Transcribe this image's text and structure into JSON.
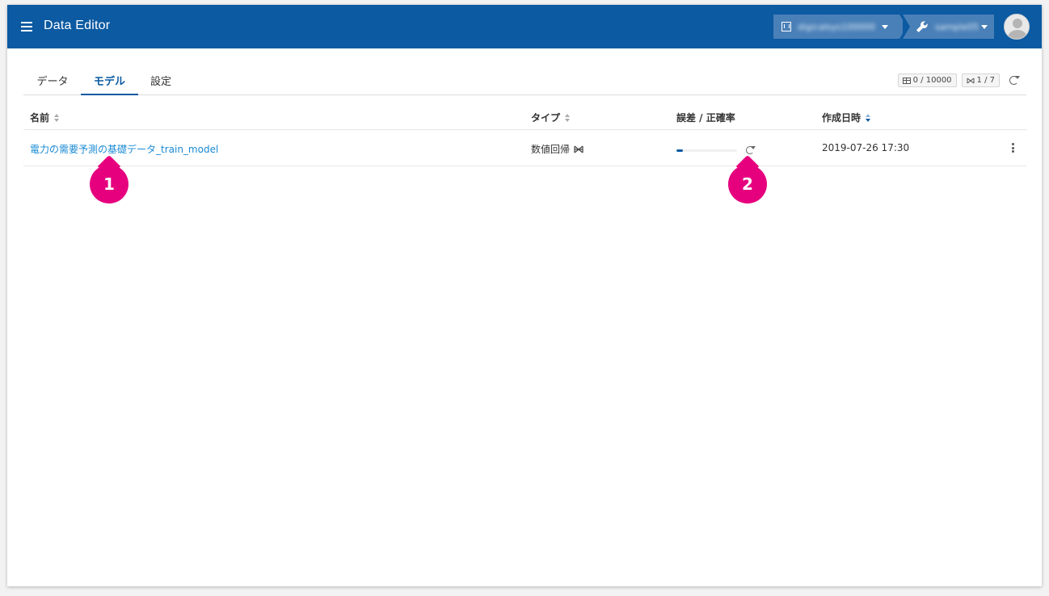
{
  "app": {
    "title": "Data Editor"
  },
  "header": {
    "organization": {
      "label": "digicalsys100000"
    },
    "project": {
      "label": "sample05"
    }
  },
  "tabs": [
    {
      "label": "データ",
      "active": false
    },
    {
      "label": "モデル",
      "active": true
    },
    {
      "label": "設定",
      "active": false
    }
  ],
  "counters": {
    "records": "0 / 10000",
    "models": "1 / 7"
  },
  "table": {
    "columns": [
      "名前",
      "タイプ",
      "誤差 / 正確率",
      "作成日時"
    ],
    "rows": [
      {
        "name": "電力の需要予測の基礎データ_train_model",
        "type": "数値回帰",
        "progress": 0.1,
        "created": "2019-07-26 17:30"
      }
    ]
  },
  "annotations": [
    "1",
    "2"
  ],
  "colors": {
    "appbar": "#0b5aa2",
    "link": "#1a8ad4",
    "callout": "#e6007e"
  }
}
